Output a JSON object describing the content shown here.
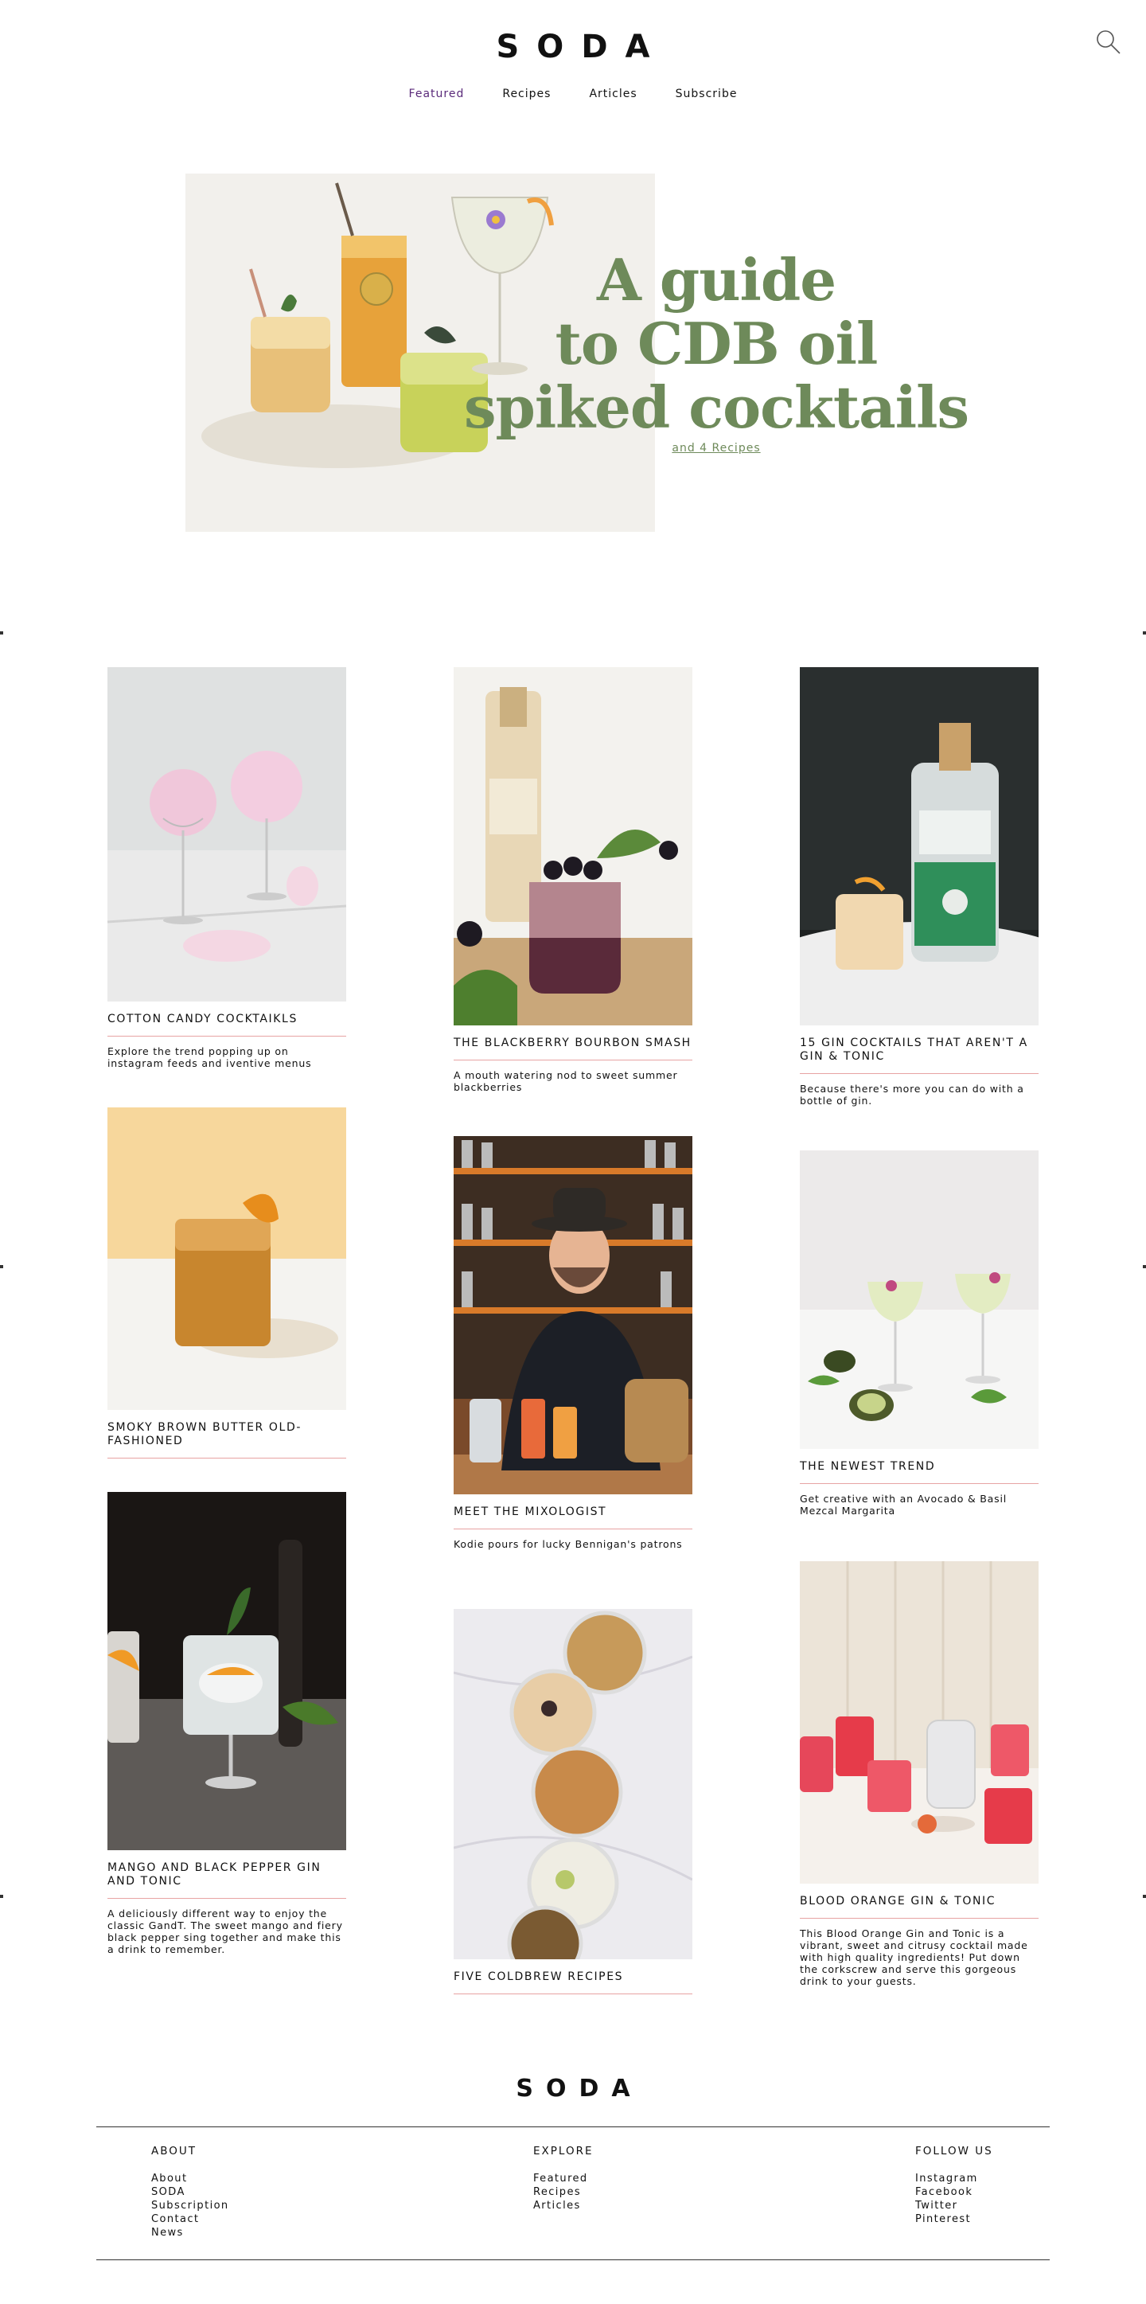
{
  "header": {
    "logo": "SODA",
    "nav": [
      {
        "label": "Featured",
        "active": true
      },
      {
        "label": "Recipes",
        "active": false
      },
      {
        "label": "Articles",
        "active": false
      },
      {
        "label": "Subscribe",
        "active": false
      }
    ],
    "search_icon": "search-icon"
  },
  "hero": {
    "title_line1": "A guide",
    "title_line2": "to CDB oil",
    "title_line3": "spiked cocktails",
    "link": "and 4 Recipes",
    "accent_color": "#6e8a5a"
  },
  "cards": [
    {
      "title": "COTTON CANDY COCKTAIKLS",
      "desc": "Explore the trend popping up on instagram feeds and iventive menus"
    },
    {
      "title": "THE BLACKBERRY BOURBON SMASH",
      "desc": "A mouth watering nod to sweet summer blackberries"
    },
    {
      "title": "15 GIN COCKTAILS THAT AREN'T A GIN & TONIC",
      "desc": "Because there's more you can do with a bottle of gin."
    },
    {
      "title": "SMOKY BROWN BUTTER OLD-FASHIONED",
      "desc": ""
    },
    {
      "title": "MEET THE MIXOLOGIST",
      "desc": "Kodie pours for lucky Bennigan's patrons"
    },
    {
      "title": "THE NEWEST TREND",
      "desc": "Get creative with an Avocado & Basil Mezcal Margarita"
    },
    {
      "title": "MANGO AND BLACK PEPPER GIN AND TONIC",
      "desc": "A deliciously different way to enjoy the classic GandT. The sweet mango and fiery black pepper sing together and make this a drink to remember."
    },
    {
      "title": "FIVE COLDBREW RECIPES",
      "desc": ""
    },
    {
      "title": "BLOOD ORANGE GIN & TONIC",
      "desc": "This Blood Orange Gin and Tonic is a vibrant, sweet and citrusy cocktail made with high quality ingredients! Put down the corkscrew and serve this gorgeous drink to your guests."
    }
  ],
  "footer": {
    "logo": "SODA",
    "about": {
      "heading": "ABOUT",
      "links": [
        "About",
        "SODA",
        "Subscription",
        "Contact",
        "News"
      ]
    },
    "explore": {
      "heading": "EXPLORE",
      "links": [
        "Featured",
        "Recipes",
        "Articles"
      ]
    },
    "follow": {
      "heading": "FOLLOW US",
      "links": [
        "Instagram",
        "Facebook",
        "Twitter",
        "Pinterest"
      ]
    }
  },
  "colors": {
    "divider": "#e7a3a3",
    "nav_active": "#5a2a7a"
  }
}
